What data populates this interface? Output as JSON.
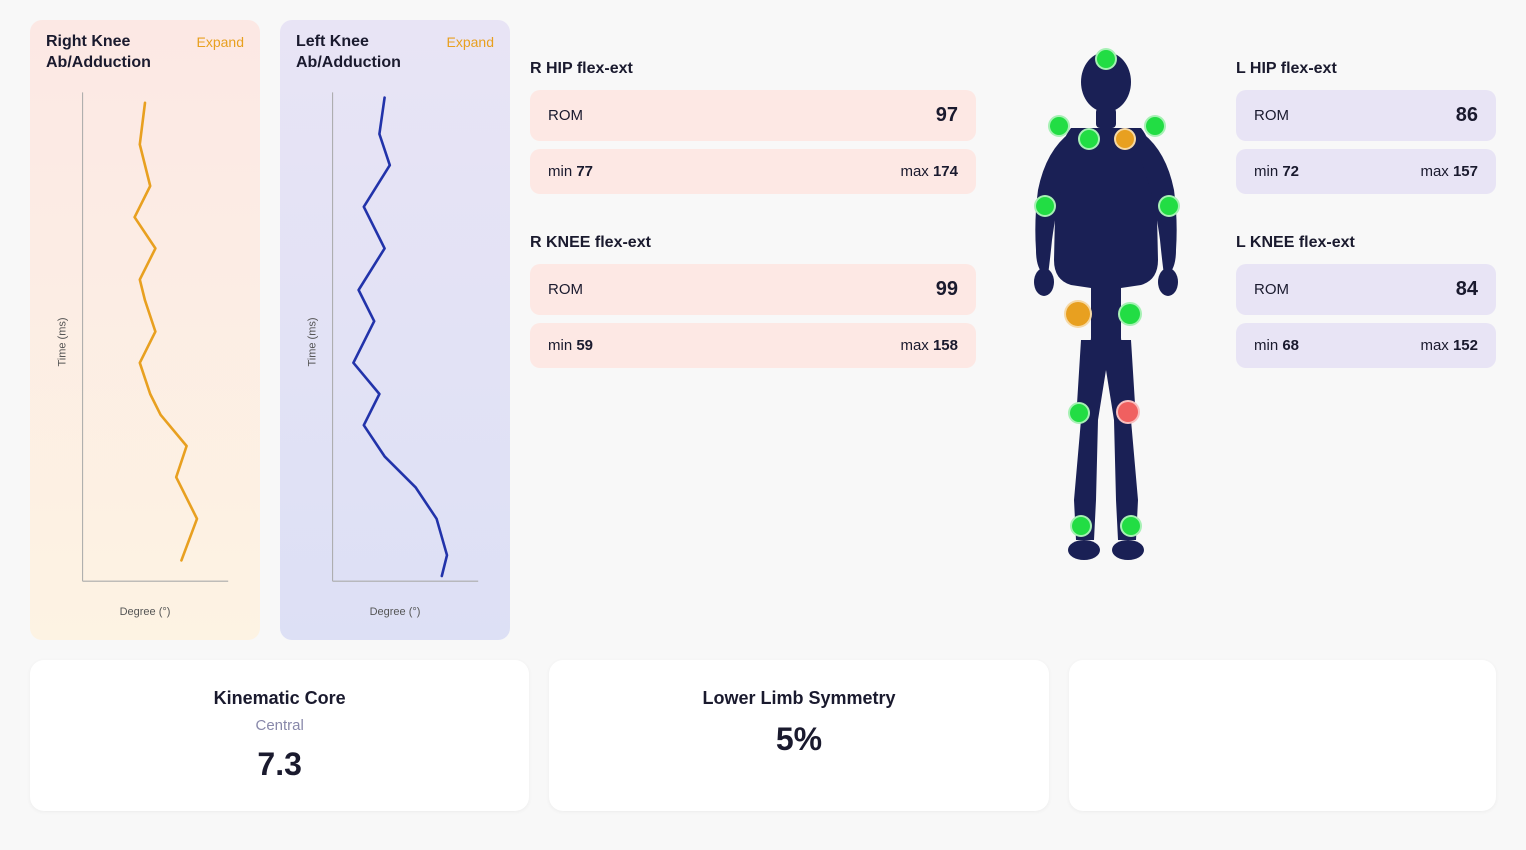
{
  "charts": {
    "right": {
      "title": "Right Knee\nAb/Adduction",
      "expand_label": "Expand",
      "y_label": "Time (ms)",
      "x_label": "Degree (°)",
      "color": "#e8a020"
    },
    "left": {
      "title": "Left Knee\nAb/Adduction",
      "expand_label": "Expand",
      "y_label": "Time (ms)",
      "x_label": "Degree (°)",
      "color": "#2233aa"
    }
  },
  "r_hip": {
    "section_title": "R HIP flex-ext",
    "rom_label": "ROM",
    "rom_value": "97",
    "min_label": "min",
    "min_value": "77",
    "max_label": "max",
    "max_value": "174"
  },
  "r_knee": {
    "section_title": "R KNEE flex-ext",
    "rom_label": "ROM",
    "rom_value": "99",
    "min_label": "min",
    "min_value": "59",
    "max_label": "max",
    "max_value": "158"
  },
  "l_hip": {
    "section_title": "L HIP flex-ext",
    "rom_label": "ROM",
    "rom_value": "86",
    "min_label": "min",
    "min_value": "72",
    "max_label": "max",
    "max_value": "157"
  },
  "l_knee": {
    "section_title": "L KNEE flex-ext",
    "rom_label": "ROM",
    "rom_value": "84",
    "min_label": "min",
    "min_value": "68",
    "max_label": "max",
    "max_value": "152"
  },
  "kinematic_core": {
    "title": "Kinematic Core",
    "subtitle": "Central",
    "value": "7.3"
  },
  "lower_limb": {
    "title": "Lower Limb Symmetry",
    "value": "5%"
  },
  "colors": {
    "green": "#22dd44",
    "orange": "#e8a020",
    "red": "#f06060",
    "navy": "#1a2055"
  }
}
